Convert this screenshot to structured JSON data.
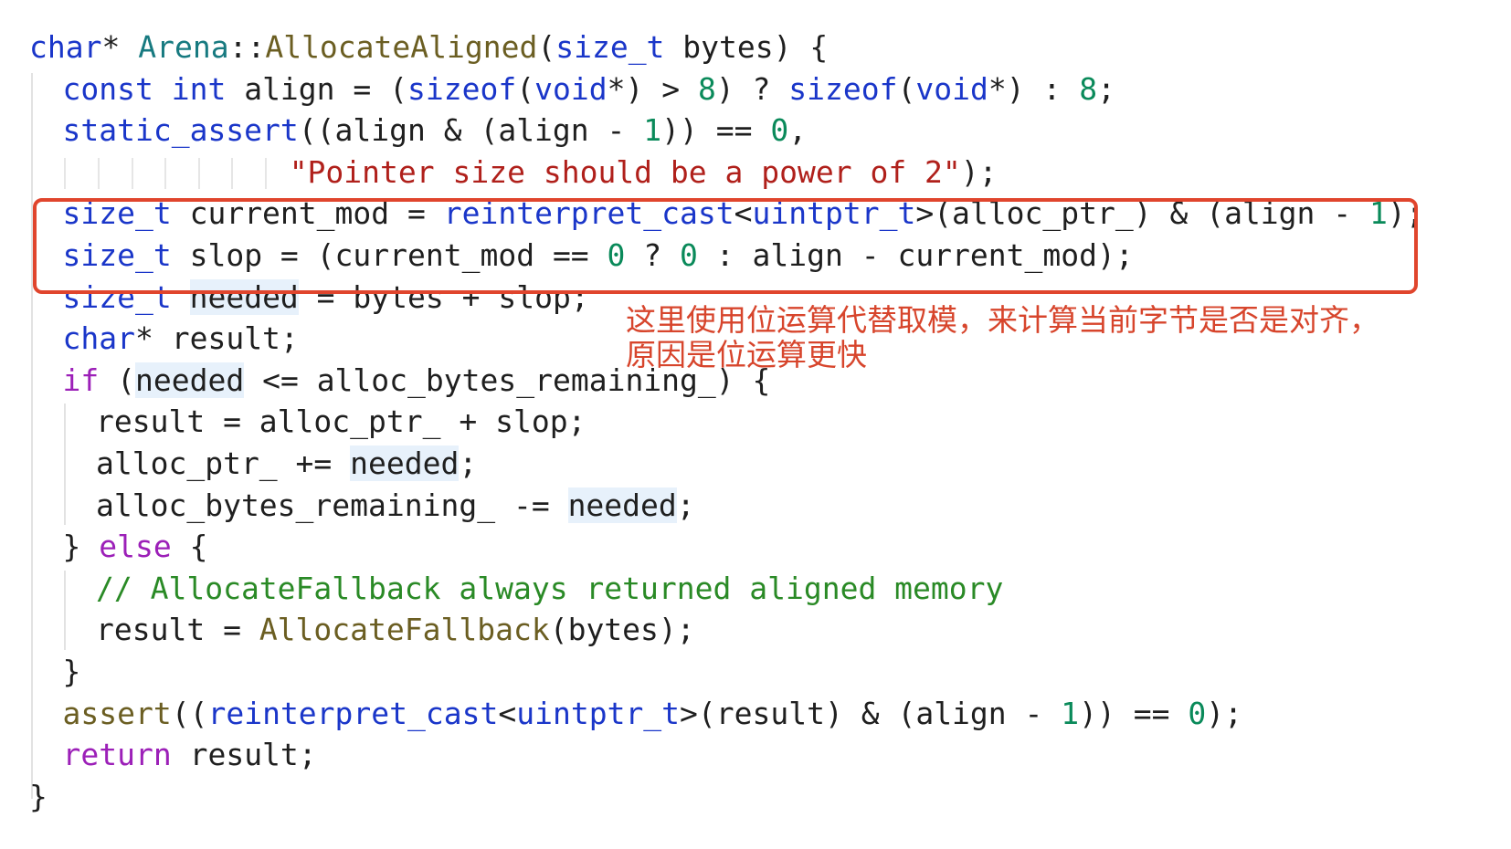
{
  "colors": {
    "keyword": "#1a36c9",
    "control_keyword": "#9c20b8",
    "class_name": "#177a80",
    "function_name": "#6b5e22",
    "number": "#0a8a5a",
    "string": "#b0201b",
    "comment": "#2a8a26",
    "highlight_box": "#e0452d",
    "annotation_text": "#d7452c"
  },
  "code": {
    "lines": [
      {
        "indent": 0,
        "tokens": [
          [
            "kw",
            "char"
          ],
          [
            "",
            "* "
          ],
          [
            "cls",
            "Arena"
          ],
          [
            "",
            "::"
          ],
          [
            "fn",
            "AllocateAligned"
          ],
          [
            "",
            "("
          ],
          [
            "kw",
            "size_t"
          ],
          [
            "",
            " bytes) {"
          ]
        ]
      },
      {
        "indent": 1,
        "tokens": [
          [
            "kw",
            "const"
          ],
          [
            "",
            " "
          ],
          [
            "kw",
            "int"
          ],
          [
            "",
            " align = ("
          ],
          [
            "kw",
            "sizeof"
          ],
          [
            "",
            "("
          ],
          [
            "kw",
            "void"
          ],
          [
            "",
            "*) > "
          ],
          [
            "num",
            "8"
          ],
          [
            "",
            ") ? "
          ],
          [
            "kw",
            "sizeof"
          ],
          [
            "",
            "("
          ],
          [
            "kw",
            "void"
          ],
          [
            "",
            "*) : "
          ],
          [
            "num",
            "8"
          ],
          [
            "",
            ";"
          ]
        ]
      },
      {
        "indent": 1,
        "tokens": [
          [
            "kw",
            "static_assert"
          ],
          [
            "",
            "((align & (align - "
          ],
          [
            "num",
            "1"
          ],
          [
            "",
            ")) == "
          ],
          [
            "num",
            "0"
          ],
          [
            "",
            ","
          ]
        ]
      },
      {
        "indent": 7.8,
        "tokens": [
          [
            "str",
            "\"Pointer size should be a power of 2\""
          ],
          [
            "",
            ");"
          ]
        ]
      },
      {
        "indent": 1,
        "tokens": [
          [
            "kw",
            "size_t"
          ],
          [
            "",
            " current_mod = "
          ],
          [
            "kw",
            "reinterpret_cast"
          ],
          [
            "",
            "<"
          ],
          [
            "kw",
            "uintptr_t"
          ],
          [
            "",
            ">(alloc_ptr_) & (align - "
          ],
          [
            "num",
            "1"
          ],
          [
            "",
            ");"
          ]
        ]
      },
      {
        "indent": 1,
        "tokens": [
          [
            "kw",
            "size_t"
          ],
          [
            "",
            " slop = (current_mod == "
          ],
          [
            "num",
            "0"
          ],
          [
            "",
            " ? "
          ],
          [
            "num",
            "0"
          ],
          [
            "",
            " : align - current_mod);"
          ]
        ]
      },
      {
        "indent": 1,
        "tokens": [
          [
            "kw",
            "size_t"
          ],
          [
            "",
            " "
          ],
          [
            "hl",
            "needed"
          ],
          [
            "",
            " = bytes + slop;"
          ]
        ]
      },
      {
        "indent": 1,
        "tokens": [
          [
            "kw",
            "char"
          ],
          [
            "",
            "* result;"
          ]
        ]
      },
      {
        "indent": 1,
        "tokens": [
          [
            "kw2",
            "if"
          ],
          [
            "",
            " ("
          ],
          [
            "hl",
            "needed"
          ],
          [
            "",
            " <= alloc_bytes_remaining_) {"
          ]
        ]
      },
      {
        "indent": 2,
        "tokens": [
          [
            "",
            "result = alloc_ptr_ + slop;"
          ]
        ]
      },
      {
        "indent": 2,
        "tokens": [
          [
            "",
            "alloc_ptr_ += "
          ],
          [
            "hl",
            "needed"
          ],
          [
            "",
            ";"
          ]
        ]
      },
      {
        "indent": 2,
        "tokens": [
          [
            "",
            "alloc_bytes_remaining_ -= "
          ],
          [
            "hl",
            "needed"
          ],
          [
            "",
            ";"
          ]
        ]
      },
      {
        "indent": 1,
        "tokens": [
          [
            "",
            "} "
          ],
          [
            "kw2",
            "else"
          ],
          [
            "",
            " {"
          ]
        ]
      },
      {
        "indent": 2,
        "tokens": [
          [
            "cmt",
            "// AllocateFallback always returned aligned memory"
          ]
        ]
      },
      {
        "indent": 2,
        "tokens": [
          [
            "",
            "result = "
          ],
          [
            "fn",
            "AllocateFallback"
          ],
          [
            "",
            "(bytes);"
          ]
        ]
      },
      {
        "indent": 1,
        "tokens": [
          [
            "",
            "}"
          ]
        ]
      },
      {
        "indent": 1,
        "tokens": [
          [
            "fn",
            "assert"
          ],
          [
            "",
            "(("
          ],
          [
            "kw",
            "reinterpret_cast"
          ],
          [
            "",
            "<"
          ],
          [
            "kw",
            "uintptr_t"
          ],
          [
            "",
            ">(result) & (align - "
          ],
          [
            "num",
            "1"
          ],
          [
            "",
            ")) == "
          ],
          [
            "num",
            "0"
          ],
          [
            "",
            ");"
          ]
        ]
      },
      {
        "indent": 1,
        "tokens": [
          [
            "kw2",
            "return"
          ],
          [
            "",
            " result;"
          ]
        ]
      },
      {
        "indent": 0,
        "tokens": [
          [
            "",
            "}"
          ]
        ]
      }
    ]
  },
  "annotation": {
    "line1": "这里使用位运算代替取模，来计算当前字节是否是对齐，",
    "line2": "原因是位运算更快"
  }
}
